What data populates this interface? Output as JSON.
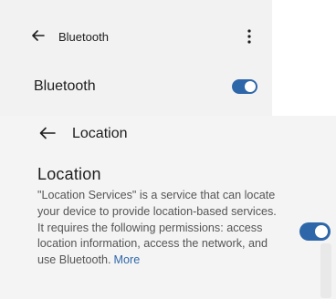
{
  "bluetooth_screen": {
    "back_icon": "arrow-left-icon",
    "title": "Bluetooth",
    "more_icon": "vertical-dots-icon",
    "row_label": "Bluetooth",
    "toggle_on": true
  },
  "location_screen": {
    "back_icon": "arrow-left-icon",
    "title": "Location",
    "heading": "Location",
    "description": "\"Location Services\" is a service that can locate your device to provide location-based services. It requires the following permissions: access location information, access the network, and use Bluetooth.",
    "more_link": "More",
    "toggle_on": true
  },
  "colors": {
    "accent": "#2e67a9",
    "panel_back": "#f2f2f2",
    "panel_front": "#f4f4f4"
  }
}
